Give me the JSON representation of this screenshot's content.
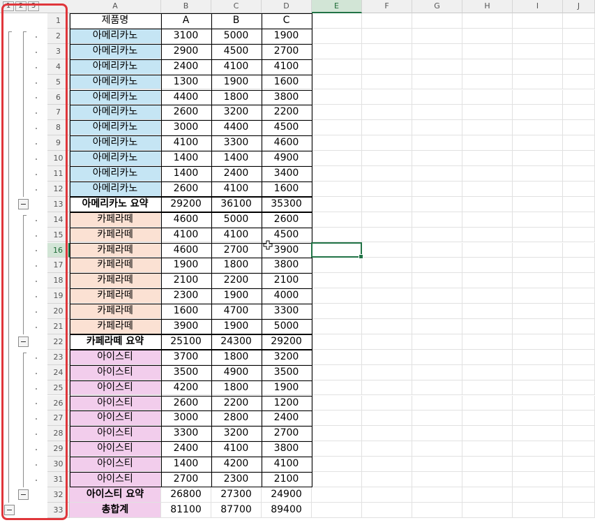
{
  "outline_levels": [
    "1",
    "2",
    "3"
  ],
  "columns": [
    "A",
    "B",
    "C",
    "D",
    "E",
    "F",
    "G",
    "H",
    "I",
    "J"
  ],
  "selected_column": "E",
  "selected_row": 16,
  "colors": {
    "americano": "#c5e5f4",
    "latte": "#fbe1d3",
    "iced_tea": "#f2cdec",
    "grid": "#e1e1e1",
    "selection": "#217346",
    "highlight_box": "#e0363b"
  },
  "rows": [
    {
      "n": "1",
      "cells": [
        "제품명",
        "A",
        "B",
        "C"
      ],
      "kind": "header"
    },
    {
      "n": "2",
      "cells": [
        "아메리카노",
        "3100",
        "5000",
        "1900"
      ],
      "kind": "americano"
    },
    {
      "n": "3",
      "cells": [
        "아메리카노",
        "2900",
        "4500",
        "2700"
      ],
      "kind": "americano"
    },
    {
      "n": "4",
      "cells": [
        "아메리카노",
        "2400",
        "4100",
        "4100"
      ],
      "kind": "americano"
    },
    {
      "n": "5",
      "cells": [
        "아메리카노",
        "1300",
        "1900",
        "1600"
      ],
      "kind": "americano"
    },
    {
      "n": "6",
      "cells": [
        "아메리카노",
        "4400",
        "1800",
        "3800"
      ],
      "kind": "americano"
    },
    {
      "n": "7",
      "cells": [
        "아메리카노",
        "2600",
        "3200",
        "2200"
      ],
      "kind": "americano"
    },
    {
      "n": "8",
      "cells": [
        "아메리카노",
        "3000",
        "4400",
        "4500"
      ],
      "kind": "americano"
    },
    {
      "n": "9",
      "cells": [
        "아메리카노",
        "4100",
        "3300",
        "4600"
      ],
      "kind": "americano"
    },
    {
      "n": "10",
      "cells": [
        "아메리카노",
        "1400",
        "1400",
        "4900"
      ],
      "kind": "americano"
    },
    {
      "n": "11",
      "cells": [
        "아메리카노",
        "1400",
        "2400",
        "3400"
      ],
      "kind": "americano"
    },
    {
      "n": "12",
      "cells": [
        "아메리카노",
        "2600",
        "4100",
        "1600"
      ],
      "kind": "americano"
    },
    {
      "n": "13",
      "cells": [
        "아메리카노 요약",
        "29200",
        "36100",
        "35300"
      ],
      "kind": "summary"
    },
    {
      "n": "14",
      "cells": [
        "카페라떼",
        "4600",
        "5000",
        "2600"
      ],
      "kind": "latte"
    },
    {
      "n": "15",
      "cells": [
        "카페라떼",
        "4100",
        "4100",
        "4500"
      ],
      "kind": "latte"
    },
    {
      "n": "16",
      "cells": [
        "카페라떼",
        "4600",
        "2700",
        "3900"
      ],
      "kind": "latte"
    },
    {
      "n": "17",
      "cells": [
        "카페라떼",
        "1900",
        "1800",
        "3800"
      ],
      "kind": "latte"
    },
    {
      "n": "18",
      "cells": [
        "카페라떼",
        "2100",
        "2200",
        "2100"
      ],
      "kind": "latte"
    },
    {
      "n": "19",
      "cells": [
        "카페라떼",
        "2300",
        "1900",
        "4000"
      ],
      "kind": "latte"
    },
    {
      "n": "20",
      "cells": [
        "카페라떼",
        "1600",
        "4700",
        "3300"
      ],
      "kind": "latte"
    },
    {
      "n": "21",
      "cells": [
        "카페라떼",
        "3900",
        "1900",
        "5000"
      ],
      "kind": "latte"
    },
    {
      "n": "22",
      "cells": [
        "카페라떼 요약",
        "25100",
        "24300",
        "29200"
      ],
      "kind": "summary"
    },
    {
      "n": "23",
      "cells": [
        "아이스티",
        "3700",
        "1800",
        "3200"
      ],
      "kind": "iced_tea"
    },
    {
      "n": "24",
      "cells": [
        "아이스티",
        "3500",
        "4900",
        "3500"
      ],
      "kind": "iced_tea"
    },
    {
      "n": "25",
      "cells": [
        "아이스티",
        "4200",
        "1800",
        "1900"
      ],
      "kind": "iced_tea"
    },
    {
      "n": "26",
      "cells": [
        "아이스티",
        "2600",
        "2200",
        "1200"
      ],
      "kind": "iced_tea"
    },
    {
      "n": "27",
      "cells": [
        "아이스티",
        "3000",
        "2800",
        "2400"
      ],
      "kind": "iced_tea"
    },
    {
      "n": "28",
      "cells": [
        "아이스티",
        "3300",
        "3200",
        "2700"
      ],
      "kind": "iced_tea"
    },
    {
      "n": "29",
      "cells": [
        "아이스티",
        "2400",
        "4100",
        "3800"
      ],
      "kind": "iced_tea"
    },
    {
      "n": "30",
      "cells": [
        "아이스티",
        "1400",
        "4200",
        "4100"
      ],
      "kind": "iced_tea"
    },
    {
      "n": "31",
      "cells": [
        "아이스티",
        "2700",
        "2300",
        "2100"
      ],
      "kind": "iced_tea"
    },
    {
      "n": "32",
      "cells": [
        "아이스티 요약",
        "26800",
        "27300",
        "24900"
      ],
      "kind": "summary_tea"
    },
    {
      "n": "33",
      "cells": [
        "총합계",
        "81100",
        "87700",
        "89400"
      ],
      "kind": "grand_total"
    }
  ]
}
